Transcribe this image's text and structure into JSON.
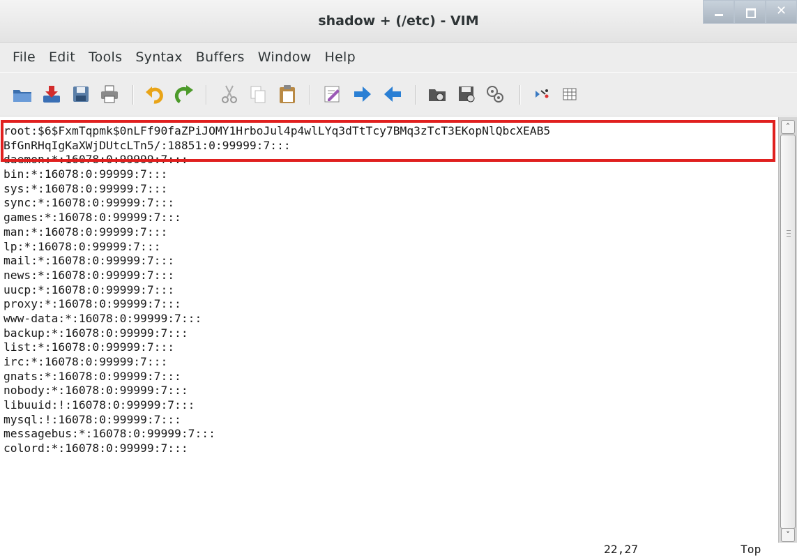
{
  "window": {
    "title": "shadow + (/etc) - VIM"
  },
  "menubar": {
    "items": [
      "File",
      "Edit",
      "Tools",
      "Syntax",
      "Buffers",
      "Window",
      "Help"
    ]
  },
  "toolbar": {
    "icons": [
      "open-icon",
      "save-download-icon",
      "save-icon",
      "print-icon",
      "undo-icon",
      "redo-icon",
      "cut-icon",
      "copy-icon",
      "paste-icon",
      "find-replace-icon",
      "forward-arrow-icon",
      "back-arrow-icon",
      "load-session-icon",
      "save-session-icon",
      "run-script-icon",
      "make-icon",
      "table-icon"
    ]
  },
  "editor": {
    "highlight_color": "#e0201f",
    "lines": [
      "root:$6$FxmTqpmk$0nLFf90faZPiJOMY1HrboJul4p4wlLYq3dTtTcy7BMq3zTcT3EKopNlQbcXEAB5",
      "BfGnRHqIgKaXWjDUtcLTn5/:18851:0:99999:7:::",
      "daemon:*:16078:0:99999:7:::",
      "bin:*:16078:0:99999:7:::",
      "sys:*:16078:0:99999:7:::",
      "sync:*:16078:0:99999:7:::",
      "games:*:16078:0:99999:7:::",
      "man:*:16078:0:99999:7:::",
      "lp:*:16078:0:99999:7:::",
      "mail:*:16078:0:99999:7:::",
      "news:*:16078:0:99999:7:::",
      "uucp:*:16078:0:99999:7:::",
      "proxy:*:16078:0:99999:7:::",
      "www-data:*:16078:0:99999:7:::",
      "backup:*:16078:0:99999:7:::",
      "list:*:16078:0:99999:7:::",
      "irc:*:16078:0:99999:7:::",
      "gnats:*:16078:0:99999:7:::",
      "nobody:*:16078:0:99999:7:::",
      "libuuid:!:16078:0:99999:7:::",
      "mysql:!:16078:0:99999:7:::",
      "messagebus:*:16078:0:99999:7:::",
      "colord:*:16078:0:99999:7:::"
    ]
  },
  "status": {
    "position": "22,27",
    "scroll": "Top"
  }
}
